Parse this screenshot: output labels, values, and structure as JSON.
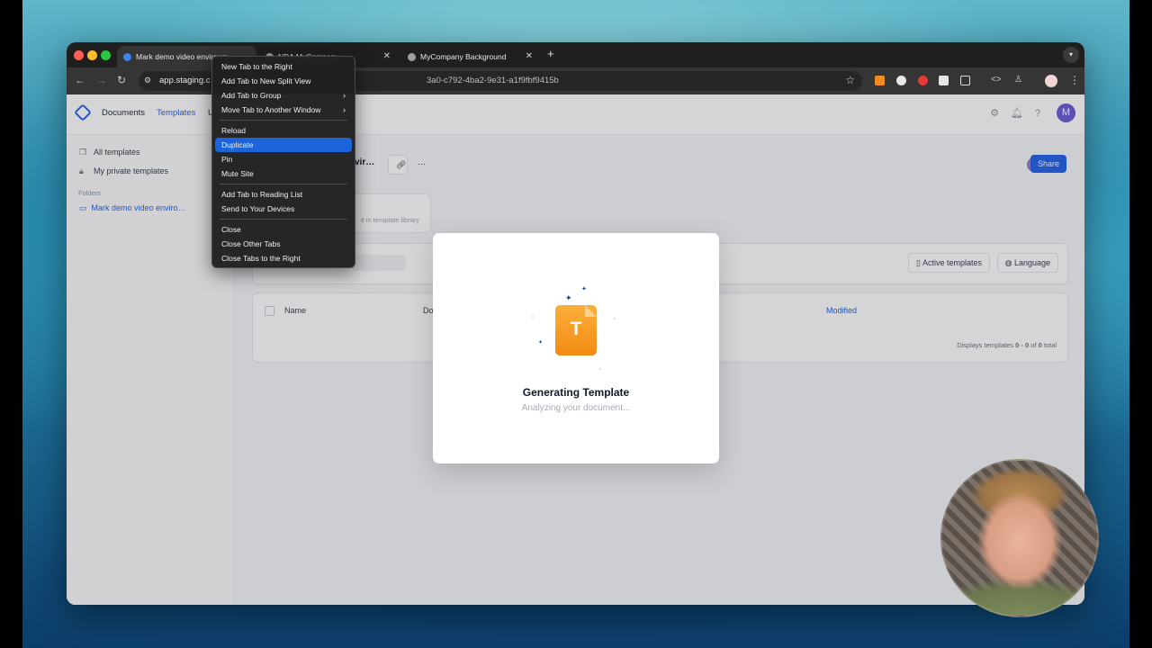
{
  "browser": {
    "tabs": [
      {
        "title": "Mark demo video environm…",
        "favicon_color": "#3b82f6"
      },
      {
        "title": "NDA MyCompany",
        "favicon_color": "#9aa0a6"
      },
      {
        "title": "MyCompany Background",
        "favicon_color": "#9aa0a6"
      }
    ],
    "new_tab": "+",
    "tab_list_icon": "chevron-down-icon",
    "url_host": "app.staging.c",
    "url_rest": "3a0-c792-4ba2-9e31-a1f9fbf9415b",
    "nav": {
      "back": "←",
      "forward": "→",
      "reload": "↻"
    }
  },
  "app": {
    "nav": {
      "documents": "Documents",
      "templates": "Templates",
      "partial": "U"
    },
    "avatar_letter": "M",
    "sidebar": {
      "items": [
        {
          "label": "All templates",
          "icon": "copy-icon"
        },
        {
          "label": "My private templates",
          "icon": "lock-icon"
        }
      ],
      "folders_label": "Folders",
      "folder": "Mark demo video enviro…"
    },
    "folder_title_partial": "vir…",
    "library_text": "d in template library",
    "share": "Share",
    "owner_avatar": "M",
    "filters": {
      "active_templates": "Active templates",
      "language": "Language"
    },
    "table": {
      "col_name": "Name",
      "col_do": "Do",
      "col_modified": "Modified"
    },
    "footer_prefix": "Displays templates ",
    "footer_range": "0 - 0",
    "footer_mid": " of ",
    "footer_total": "0",
    "footer_suffix": " total"
  },
  "context_menu": {
    "items": [
      {
        "label": "New Tab to the Right"
      },
      {
        "label": "Add Tab to New Split View"
      },
      {
        "label": "Add Tab to Group",
        "submenu": true
      },
      {
        "label": "Move Tab to Another Window",
        "submenu": true
      },
      {
        "label": "Reload"
      },
      {
        "label": "Duplicate",
        "highlighted": true
      },
      {
        "label": "Pin"
      },
      {
        "label": "Mute Site"
      },
      {
        "label": "Add Tab to Reading List"
      },
      {
        "label": "Send to Your Devices"
      },
      {
        "label": "Close"
      },
      {
        "label": "Close Other Tabs"
      },
      {
        "label": "Close Tabs to the Right"
      }
    ]
  },
  "modal": {
    "icon_letter": "T",
    "title": "Generating Template",
    "subtitle": "Analyzing your document..."
  },
  "colors": {
    "accent": "#2463eb",
    "menu_highlight": "#1b64da",
    "doc_icon": "#f6a025"
  }
}
